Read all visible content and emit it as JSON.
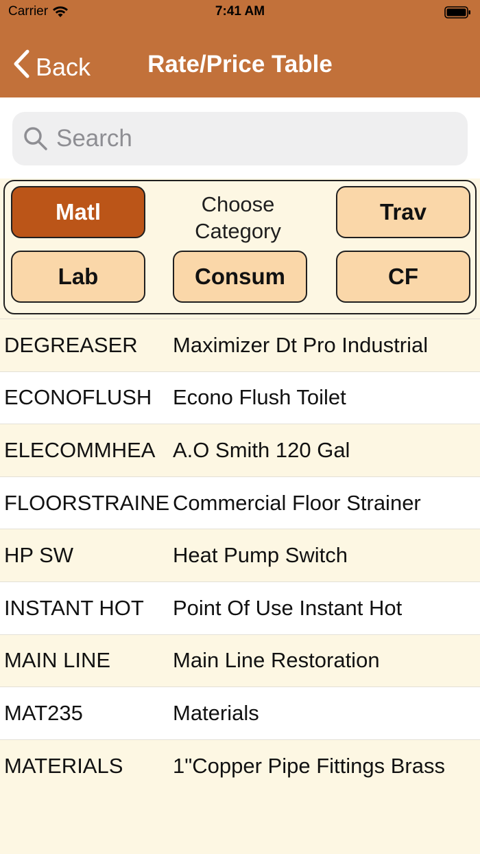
{
  "status_bar": {
    "carrier": "Carrier",
    "time": "7:41 AM"
  },
  "nav": {
    "back_label": "Back",
    "title": "Rate/Price Table"
  },
  "search": {
    "placeholder": "Search",
    "value": ""
  },
  "category": {
    "label": "Choose Category",
    "buttons": [
      {
        "label": "Matl",
        "selected": true
      },
      {
        "label": "Trav",
        "selected": false
      },
      {
        "label": "Lab",
        "selected": false
      },
      {
        "label": "Consum",
        "selected": false
      },
      {
        "label": "CF",
        "selected": false
      }
    ]
  },
  "rows": [
    {
      "code": "DEGREASER",
      "desc": "Maximizer Dt Pro Industrial"
    },
    {
      "code": "ECONOFLUSH",
      "desc": "Econo Flush Toilet"
    },
    {
      "code": "ELECOMMHEA",
      "desc": "A.O Smith 120 Gal"
    },
    {
      "code": "FLOORSTRAINE",
      "desc": "Commercial Floor Strainer"
    },
    {
      "code": "HP SW",
      "desc": "Heat Pump Switch"
    },
    {
      "code": "INSTANT HOT",
      "desc": "Point Of Use Instant Hot"
    },
    {
      "code": "MAIN LINE",
      "desc": "Main Line Restoration"
    },
    {
      "code": "MAT235",
      "desc": "Materials"
    },
    {
      "code": "MATERIALS",
      "desc": "1\"Copper Pipe Fittings Brass"
    }
  ],
  "colors": {
    "header": "#c2713a",
    "active_button": "#bb5518",
    "button": "#fad7a9",
    "row_alt": "#fdf7e3"
  }
}
